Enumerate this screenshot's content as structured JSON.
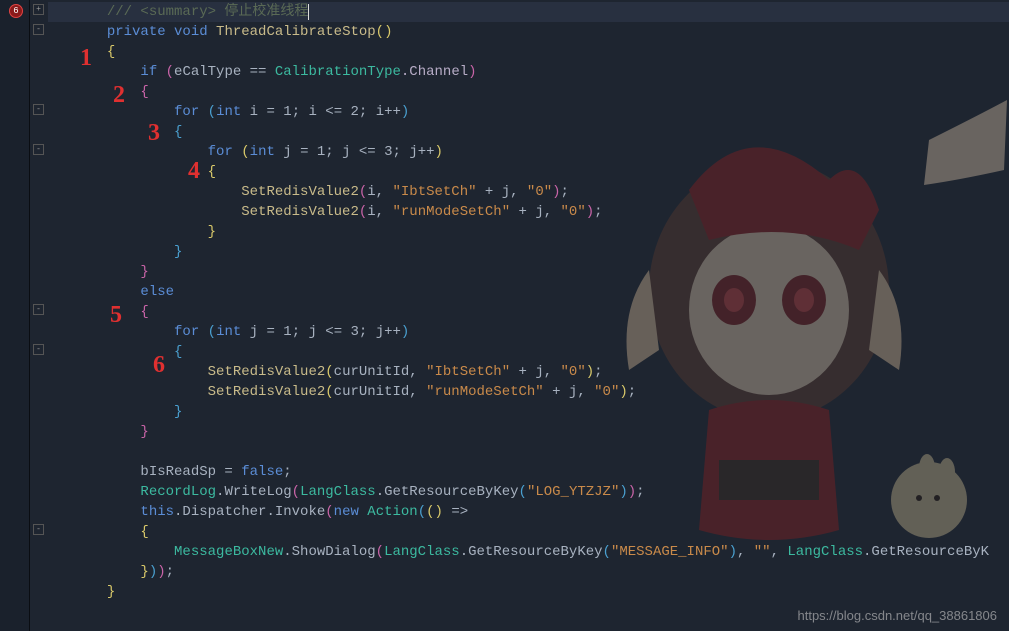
{
  "breakpoint": {
    "label": "6"
  },
  "annotations": {
    "a1": "1",
    "a2": "2",
    "a3": "3",
    "a4": "4",
    "a5": "5",
    "a6": "6"
  },
  "code": {
    "l0_comment": "/// <summary> 停止校准线程",
    "l1_kw1": "private",
    "l1_kw2": "void",
    "l1_name": " ThreadCalibrateStop",
    "l3_kw": "if",
    "l3_var": "eCalType == ",
    "l3_type": "CalibrationType",
    "l3_prop": ".Channel",
    "l5_kw": "for",
    "l5_body": "int",
    "l5_rest": " i = 1; i <= 2; i++",
    "l7_kw": "for",
    "l7_body": "int",
    "l7_rest": " j = 1; j <= 3; j++",
    "l9a": "SetRedisValue2",
    "l9b": "i, ",
    "l9s1": "\"IbtSetCh\"",
    "l9c": " + j, ",
    "l9s2": "\"0\"",
    "l10a": "SetRedisValue2",
    "l10b": "i, ",
    "l10s1": "\"runModeSetCh\"",
    "l10c": " + j, ",
    "l10s2": "\"0\"",
    "l14_kw": "else",
    "l16_kw": "for",
    "l16_body": "int",
    "l16_rest": " j = 1; j <= 3; j++",
    "l18a": "SetRedisValue2",
    "l18b": "curUnitId, ",
    "l18s1": "\"IbtSetCh\"",
    "l18c": " + j, ",
    "l18s2": "\"0\"",
    "l19a": "SetRedisValue2",
    "l19b": "curUnitId, ",
    "l19s1": "\"runModeSetCh\"",
    "l19c": " + j, ",
    "l19s2": "\"0\"",
    "l23a": "bIsReadSp = ",
    "l23kw": "false",
    "l24a": "RecordLog",
    "l24b": ".WriteLog",
    "l24c": "LangClass",
    "l24d": ".GetResourceByKey",
    "l24s": "\"LOG_YTZJZ\"",
    "l25a": "this",
    "l25b": ".Dispatcher.Invoke",
    "l25c": "new",
    "l25d": " Action",
    "l27a": "MessageBoxNew",
    "l27b": ".ShowDialog",
    "l27c": "LangClass",
    "l27d": ".GetResourceByKey",
    "l27s1": "\"MESSAGE_INFO\"",
    "l27s2": "\"\"",
    "l27e": "LangClass",
    "l27f": ".GetResourceByK"
  },
  "watermark": "https://blog.csdn.net/qq_38861806"
}
